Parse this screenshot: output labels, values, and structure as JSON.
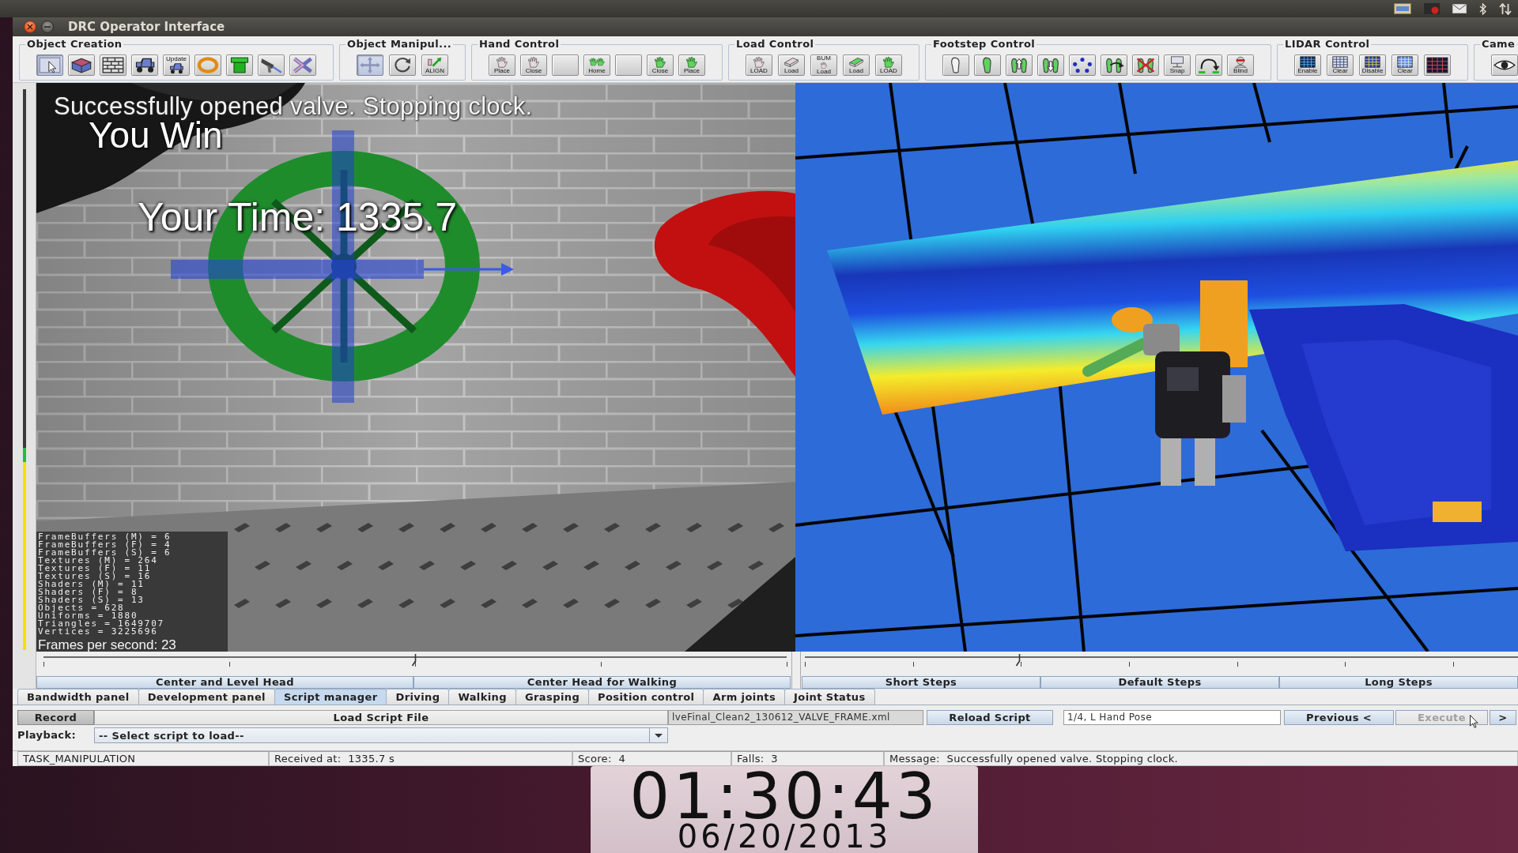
{
  "window": {
    "title": "DRC Operator Interface"
  },
  "toolbar": [
    {
      "title": "Object Creation",
      "buttons": [
        {
          "selected": true
        },
        {
          "selected": false
        },
        {
          "selected": false
        },
        {
          "selected": false
        },
        {
          "label_top": "Update",
          "selected": false
        },
        {
          "selected": false
        },
        {
          "selected": false
        },
        {
          "selected": false
        },
        {
          "selected": false
        }
      ]
    },
    {
      "title": "Object Manipul...",
      "buttons": [
        {
          "selected": true
        },
        {
          "selected": false
        },
        {
          "label": "ALIGN",
          "selected": false
        }
      ]
    },
    {
      "title": "Hand Control",
      "buttons": [
        {
          "label": "Place",
          "selected": false
        },
        {
          "label": "Close",
          "selected": false
        },
        {
          "selected": false
        },
        {
          "label": "Home",
          "selected": false
        },
        {
          "selected": false
        },
        {
          "label": "Close",
          "selected": false
        },
        {
          "label": "Place",
          "selected": false
        }
      ]
    },
    {
      "title": "Load Control",
      "buttons": [
        {
          "label": "LOAD",
          "selected": false
        },
        {
          "label": "Load",
          "selected": false
        },
        {
          "label_top": "BUM",
          "label": "Load",
          "selected": false
        },
        {
          "label": "Load",
          "selected": false
        },
        {
          "label": "LOAD",
          "selected": false
        }
      ]
    },
    {
      "title": "Footstep Control",
      "buttons": [
        {
          "selected": false
        },
        {
          "selected": false
        },
        {
          "selected": false
        },
        {
          "selected": false
        },
        {
          "selected": false
        },
        {
          "selected": false
        },
        {
          "selected": false
        },
        {
          "label": "Snap",
          "selected": false
        },
        {
          "selected": false
        },
        {
          "label": "Blind",
          "selected": false
        }
      ]
    },
    {
      "title": "LIDAR Control",
      "buttons": [
        {
          "label": "Enable",
          "selected": false
        },
        {
          "label": "Clear",
          "selected": false
        },
        {
          "label": "Disable",
          "selected": false
        },
        {
          "label": "Clear",
          "selected": false
        },
        {
          "selected": false
        }
      ]
    },
    {
      "title": "Came",
      "buttons": [
        {
          "selected": false
        }
      ]
    }
  ],
  "camera_view": {
    "status_message": "Successfully opened valve. Stopping clock.",
    "result": "You Win",
    "time": "Your Time: 1335.7",
    "stats": [
      "FrameBuffers (M) = 6",
      "FrameBuffers (F) = 4",
      "FrameBuffers (S) = 6",
      "Textures (M) = 264",
      "Textures (F) = 11",
      "Textures (S) = 16",
      "Shaders (M) = 11",
      "Shaders (F) = 8",
      "Shaders (S) = 13",
      "Objects = 628",
      "Uniforms = 1880",
      "Triangles = 1649707",
      "Vertices = 3225696"
    ],
    "fps": "Frames per second: 23"
  },
  "vertical_slider": {
    "level": 0.36
  },
  "head_controls": {
    "level": 0.5,
    "presets": [
      "Center and Level Head",
      "Center Head for Walking"
    ]
  },
  "step_controls": {
    "level": 0.3,
    "presets": [
      "Short Steps",
      "Default Steps",
      "Long Steps"
    ]
  },
  "tabs": [
    {
      "label": "Bandwidth panel",
      "selected": false
    },
    {
      "label": "Development panel",
      "selected": false
    },
    {
      "label": "Script manager",
      "selected": true
    },
    {
      "label": "Driving",
      "selected": false
    },
    {
      "label": "Walking",
      "selected": false
    },
    {
      "label": "Grasping",
      "selected": false
    },
    {
      "label": "Position control",
      "selected": false
    },
    {
      "label": "Arm joints",
      "selected": false
    },
    {
      "label": "Joint Status",
      "selected": false
    }
  ],
  "script_manager": {
    "record_button": "Record",
    "load_button": "Load Script File",
    "file_field": "lveFinal_Clean2_130612_VALVE_FRAME.xml",
    "reload_button": "Reload Script",
    "step_field": "1/4, L Hand Pose",
    "previous_button": "Previous <",
    "execute_button": {
      "label": "Execute",
      "disabled": true
    },
    "next_button": ">",
    "playback_label": "Playback:",
    "playback_select": "-- Select script to load--"
  },
  "status_bar": [
    "TASK_MANIPULATION",
    "Received at:  1335.7 s",
    "Score:  4",
    "Falls:  3",
    "Message:  Successfully opened valve. Stopping clock."
  ],
  "clock": {
    "time": "01:30:43",
    "date": "06/20/2013"
  }
}
